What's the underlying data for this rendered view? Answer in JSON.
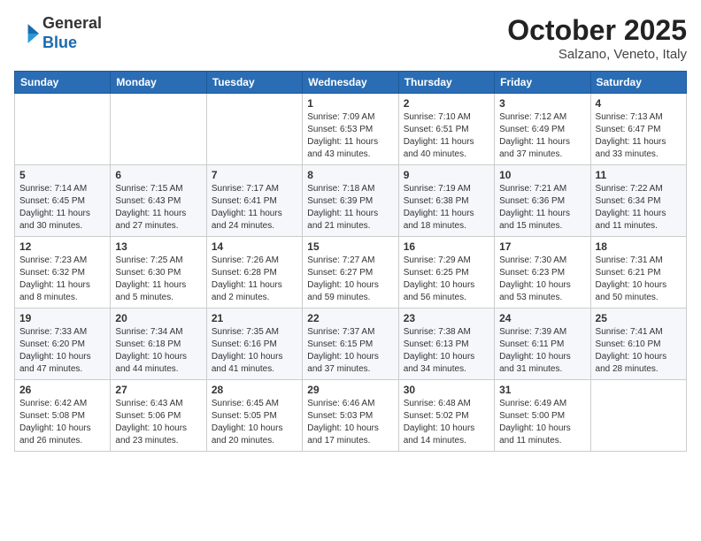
{
  "logo": {
    "general": "General",
    "blue": "Blue"
  },
  "title": "October 2025",
  "subtitle": "Salzano, Veneto, Italy",
  "weekdays": [
    "Sunday",
    "Monday",
    "Tuesday",
    "Wednesday",
    "Thursday",
    "Friday",
    "Saturday"
  ],
  "weeks": [
    [
      null,
      null,
      null,
      {
        "day": "1",
        "sunrise": "Sunrise: 7:09 AM",
        "sunset": "Sunset: 6:53 PM",
        "daylight": "Daylight: 11 hours and 43 minutes."
      },
      {
        "day": "2",
        "sunrise": "Sunrise: 7:10 AM",
        "sunset": "Sunset: 6:51 PM",
        "daylight": "Daylight: 11 hours and 40 minutes."
      },
      {
        "day": "3",
        "sunrise": "Sunrise: 7:12 AM",
        "sunset": "Sunset: 6:49 PM",
        "daylight": "Daylight: 11 hours and 37 minutes."
      },
      {
        "day": "4",
        "sunrise": "Sunrise: 7:13 AM",
        "sunset": "Sunset: 6:47 PM",
        "daylight": "Daylight: 11 hours and 33 minutes."
      }
    ],
    [
      {
        "day": "5",
        "sunrise": "Sunrise: 7:14 AM",
        "sunset": "Sunset: 6:45 PM",
        "daylight": "Daylight: 11 hours and 30 minutes."
      },
      {
        "day": "6",
        "sunrise": "Sunrise: 7:15 AM",
        "sunset": "Sunset: 6:43 PM",
        "daylight": "Daylight: 11 hours and 27 minutes."
      },
      {
        "day": "7",
        "sunrise": "Sunrise: 7:17 AM",
        "sunset": "Sunset: 6:41 PM",
        "daylight": "Daylight: 11 hours and 24 minutes."
      },
      {
        "day": "8",
        "sunrise": "Sunrise: 7:18 AM",
        "sunset": "Sunset: 6:39 PM",
        "daylight": "Daylight: 11 hours and 21 minutes."
      },
      {
        "day": "9",
        "sunrise": "Sunrise: 7:19 AM",
        "sunset": "Sunset: 6:38 PM",
        "daylight": "Daylight: 11 hours and 18 minutes."
      },
      {
        "day": "10",
        "sunrise": "Sunrise: 7:21 AM",
        "sunset": "Sunset: 6:36 PM",
        "daylight": "Daylight: 11 hours and 15 minutes."
      },
      {
        "day": "11",
        "sunrise": "Sunrise: 7:22 AM",
        "sunset": "Sunset: 6:34 PM",
        "daylight": "Daylight: 11 hours and 11 minutes."
      }
    ],
    [
      {
        "day": "12",
        "sunrise": "Sunrise: 7:23 AM",
        "sunset": "Sunset: 6:32 PM",
        "daylight": "Daylight: 11 hours and 8 minutes."
      },
      {
        "day": "13",
        "sunrise": "Sunrise: 7:25 AM",
        "sunset": "Sunset: 6:30 PM",
        "daylight": "Daylight: 11 hours and 5 minutes."
      },
      {
        "day": "14",
        "sunrise": "Sunrise: 7:26 AM",
        "sunset": "Sunset: 6:28 PM",
        "daylight": "Daylight: 11 hours and 2 minutes."
      },
      {
        "day": "15",
        "sunrise": "Sunrise: 7:27 AM",
        "sunset": "Sunset: 6:27 PM",
        "daylight": "Daylight: 10 hours and 59 minutes."
      },
      {
        "day": "16",
        "sunrise": "Sunrise: 7:29 AM",
        "sunset": "Sunset: 6:25 PM",
        "daylight": "Daylight: 10 hours and 56 minutes."
      },
      {
        "day": "17",
        "sunrise": "Sunrise: 7:30 AM",
        "sunset": "Sunset: 6:23 PM",
        "daylight": "Daylight: 10 hours and 53 minutes."
      },
      {
        "day": "18",
        "sunrise": "Sunrise: 7:31 AM",
        "sunset": "Sunset: 6:21 PM",
        "daylight": "Daylight: 10 hours and 50 minutes."
      }
    ],
    [
      {
        "day": "19",
        "sunrise": "Sunrise: 7:33 AM",
        "sunset": "Sunset: 6:20 PM",
        "daylight": "Daylight: 10 hours and 47 minutes."
      },
      {
        "day": "20",
        "sunrise": "Sunrise: 7:34 AM",
        "sunset": "Sunset: 6:18 PM",
        "daylight": "Daylight: 10 hours and 44 minutes."
      },
      {
        "day": "21",
        "sunrise": "Sunrise: 7:35 AM",
        "sunset": "Sunset: 6:16 PM",
        "daylight": "Daylight: 10 hours and 41 minutes."
      },
      {
        "day": "22",
        "sunrise": "Sunrise: 7:37 AM",
        "sunset": "Sunset: 6:15 PM",
        "daylight": "Daylight: 10 hours and 37 minutes."
      },
      {
        "day": "23",
        "sunrise": "Sunrise: 7:38 AM",
        "sunset": "Sunset: 6:13 PM",
        "daylight": "Daylight: 10 hours and 34 minutes."
      },
      {
        "day": "24",
        "sunrise": "Sunrise: 7:39 AM",
        "sunset": "Sunset: 6:11 PM",
        "daylight": "Daylight: 10 hours and 31 minutes."
      },
      {
        "day": "25",
        "sunrise": "Sunrise: 7:41 AM",
        "sunset": "Sunset: 6:10 PM",
        "daylight": "Daylight: 10 hours and 28 minutes."
      }
    ],
    [
      {
        "day": "26",
        "sunrise": "Sunrise: 6:42 AM",
        "sunset": "Sunset: 5:08 PM",
        "daylight": "Daylight: 10 hours and 26 minutes."
      },
      {
        "day": "27",
        "sunrise": "Sunrise: 6:43 AM",
        "sunset": "Sunset: 5:06 PM",
        "daylight": "Daylight: 10 hours and 23 minutes."
      },
      {
        "day": "28",
        "sunrise": "Sunrise: 6:45 AM",
        "sunset": "Sunset: 5:05 PM",
        "daylight": "Daylight: 10 hours and 20 minutes."
      },
      {
        "day": "29",
        "sunrise": "Sunrise: 6:46 AM",
        "sunset": "Sunset: 5:03 PM",
        "daylight": "Daylight: 10 hours and 17 minutes."
      },
      {
        "day": "30",
        "sunrise": "Sunrise: 6:48 AM",
        "sunset": "Sunset: 5:02 PM",
        "daylight": "Daylight: 10 hours and 14 minutes."
      },
      {
        "day": "31",
        "sunrise": "Sunrise: 6:49 AM",
        "sunset": "Sunset: 5:00 PM",
        "daylight": "Daylight: 10 hours and 11 minutes."
      },
      null
    ]
  ]
}
